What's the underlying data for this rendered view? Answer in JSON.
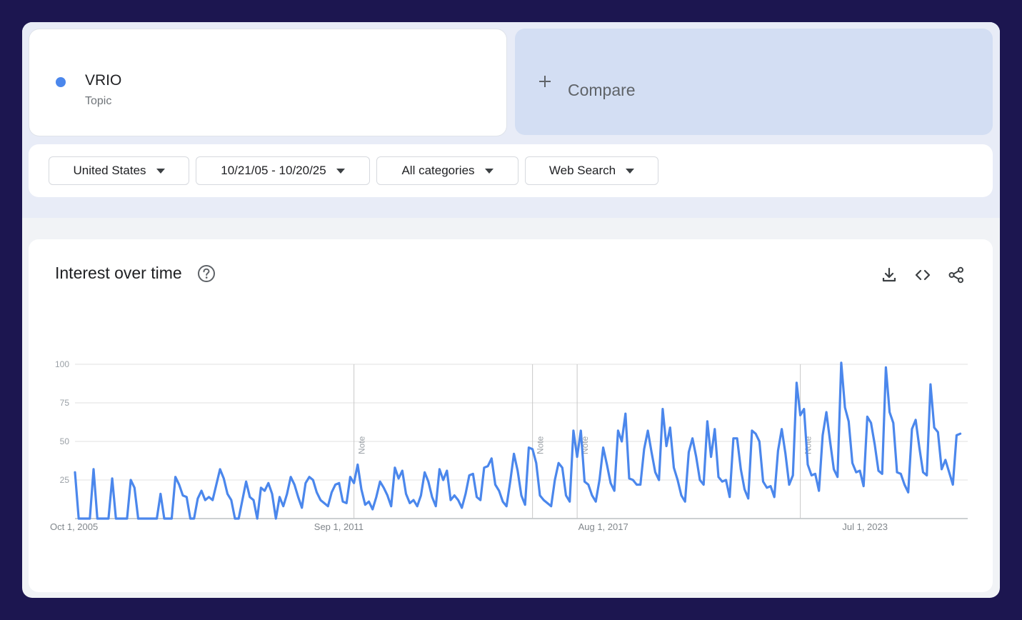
{
  "term": {
    "name": "VRIO",
    "type": "Topic",
    "color": "#4b87ec"
  },
  "compare": {
    "label": "Compare"
  },
  "filters": {
    "region": "United States",
    "date_range": "10/21/05 - 10/20/25",
    "category": "All categories",
    "search_type": "Web Search"
  },
  "chart": {
    "title": "Interest over time",
    "icons": [
      "help-icon",
      "download-icon",
      "embed-code-icon",
      "share-icon"
    ],
    "note_label": "Note"
  },
  "chart_data": {
    "type": "line",
    "title": "Interest over time",
    "xlabel": "",
    "ylabel": "",
    "ylim": [
      0,
      100
    ],
    "yticks": [
      25,
      50,
      75,
      100
    ],
    "xticks": [
      "Oct 1, 2005",
      "Sep 1, 2011",
      "Aug 1, 2017",
      "Jul 1, 2023"
    ],
    "x_range": [
      "2005-10",
      "2025-10"
    ],
    "grid": true,
    "notes": [
      "2012-01",
      "2016-01",
      "2017-01",
      "2022-01"
    ],
    "series": [
      {
        "color": "#4b87ec",
        "start": "2005-10",
        "interval": "month",
        "values": [
          30,
          0,
          0,
          0,
          0,
          32,
          0,
          0,
          0,
          0,
          26,
          0,
          0,
          0,
          0,
          25,
          20,
          0,
          0,
          0,
          0,
          0,
          0,
          16,
          0,
          0,
          0,
          27,
          22,
          15,
          14,
          0,
          0,
          13,
          18,
          12,
          14,
          12,
          22,
          32,
          26,
          16,
          12,
          0,
          0,
          12,
          24,
          14,
          12,
          0,
          20,
          18,
          23,
          16,
          0,
          14,
          8,
          16,
          27,
          22,
          14,
          7,
          23,
          27,
          25,
          17,
          12,
          10,
          8,
          17,
          22,
          23,
          11,
          10,
          27,
          23,
          35,
          19,
          9,
          11,
          6,
          14,
          24,
          20,
          15,
          8,
          33,
          26,
          31,
          16,
          10,
          12,
          8,
          15,
          30,
          24,
          14,
          8,
          32,
          25,
          31,
          12,
          15,
          12,
          7,
          16,
          28,
          29,
          14,
          12,
          33,
          34,
          39,
          22,
          18,
          11,
          8,
          24,
          42,
          31,
          15,
          9,
          46,
          45,
          36,
          15,
          12,
          10,
          8,
          25,
          36,
          33,
          15,
          11,
          57,
          40,
          57,
          24,
          22,
          15,
          11,
          25,
          46,
          35,
          23,
          18,
          57,
          50,
          68,
          26,
          25,
          22,
          22,
          45,
          57,
          43,
          30,
          25,
          71,
          47,
          59,
          33,
          25,
          15,
          11,
          43,
          52,
          40,
          25,
          22,
          63,
          40,
          58,
          27,
          24,
          25,
          14,
          52,
          52,
          32,
          19,
          13,
          57,
          55,
          50,
          24,
          20,
          21,
          14,
          44,
          58,
          42,
          22,
          28,
          88,
          67,
          71,
          35,
          28,
          29,
          18,
          54,
          69,
          50,
          32,
          27,
          101,
          72,
          63,
          36,
          30,
          31,
          21,
          66,
          62,
          48,
          31,
          29,
          98,
          69,
          62,
          30,
          29,
          22,
          17,
          58,
          64,
          46,
          30,
          28,
          87,
          59,
          56,
          32,
          38,
          30,
          22,
          54,
          55
        ]
      }
    ]
  }
}
